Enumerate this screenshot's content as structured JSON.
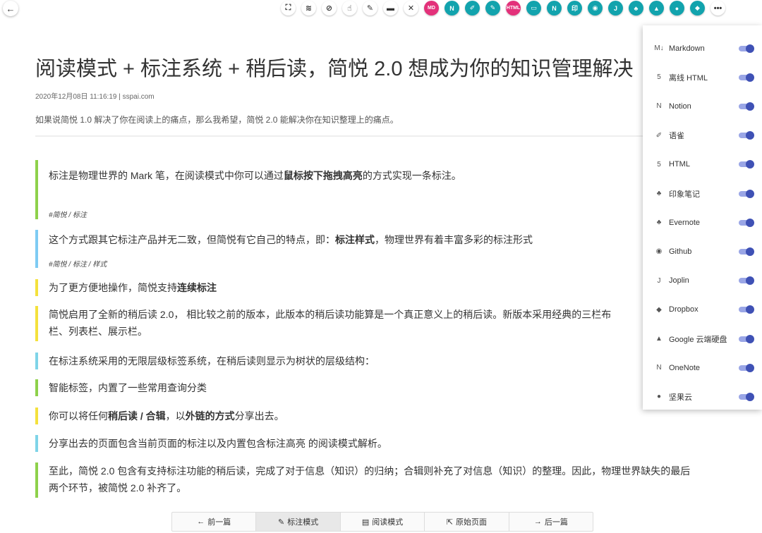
{
  "toolbar": {
    "back_icon": "←",
    "buttons": [
      {
        "name": "fullscreen-icon",
        "glyph": "⛶",
        "style": "light"
      },
      {
        "name": "layers-icon",
        "glyph": "≋",
        "style": "light"
      },
      {
        "name": "link-icon",
        "glyph": "⊘",
        "style": "light"
      },
      {
        "name": "hand-pointer-icon",
        "glyph": "☝",
        "style": "light"
      },
      {
        "name": "pen-icon",
        "glyph": "✎",
        "style": "light"
      },
      {
        "name": "archive-icon",
        "glyph": "▬",
        "style": "light"
      },
      {
        "name": "close-icon",
        "glyph": "✕",
        "style": "light"
      },
      {
        "name": "markdown-icon",
        "glyph": "MD",
        "style": "pink"
      },
      {
        "name": "notion-icon",
        "glyph": "N",
        "style": "teal"
      },
      {
        "name": "yuque-icon",
        "glyph": "✐",
        "style": "teal"
      },
      {
        "name": "pen-share-icon",
        "glyph": "✎",
        "style": "teal"
      },
      {
        "name": "html-icon",
        "glyph": "HTML",
        "style": "pink"
      },
      {
        "name": "message-icon",
        "glyph": "▭",
        "style": "teal"
      },
      {
        "name": "onenote-icon",
        "glyph": "N",
        "style": "teal"
      },
      {
        "name": "evernote-cn-icon",
        "glyph": "印",
        "style": "teal"
      },
      {
        "name": "github-icon",
        "glyph": "◉",
        "style": "teal"
      },
      {
        "name": "joplin-icon",
        "glyph": "J",
        "style": "teal"
      },
      {
        "name": "evernote-icon",
        "glyph": "♣",
        "style": "teal"
      },
      {
        "name": "google-drive-icon",
        "glyph": "▲",
        "style": "teal"
      },
      {
        "name": "jianguoyun-icon",
        "glyph": "●",
        "style": "teal"
      },
      {
        "name": "dropbox-icon",
        "glyph": "◆",
        "style": "teal"
      },
      {
        "name": "more-icon",
        "glyph": "•••",
        "style": "light"
      }
    ]
  },
  "article": {
    "title": "阅读模式 + 标注系统 + 稍后读，简悦 2.0 想成为你的知识管理解决",
    "meta": "2020年12月08日 11:16:19 | sspai.com",
    "description": "如果说简悦 1.0 解决了你在阅读上的痛点，那么我希望，简悦 2.0 能解决你在知识整理上的痛点。"
  },
  "blocks": [
    {
      "text_pre": "标注是物理世界的 Mark 笔，在阅读模式中你可以通过",
      "text_bold": "鼠标按下拖拽高亮",
      "text_post": "的方式实现一条标注。",
      "tag": "#简悦 / 标注",
      "color": "#8ed14b"
    },
    {
      "text_pre": "这个方式跟其它标注产品并无二致，但简悦有它自己的特点，即：",
      "text_bold": "标注样式",
      "text_post": "，物理世界有着丰富多彩的标注形式",
      "tag": "#简悦 / 标注 / 样式",
      "color": "#7ecbf3"
    },
    {
      "text_pre": "为了更方便地操作，简悦支持",
      "text_bold": "连续标注",
      "text_post": "",
      "color": "#f4e13c"
    },
    {
      "line1": "简悦启用了全新的稍后读 2.0， 相比较之前的版本，此版本的稍后读功能算是一个真正意义上的稍后读。新版本采用经典的三栏布",
      "line2": "栏、列表栏、展示栏。",
      "color": "#f4e13c"
    },
    {
      "text": "在标注系统采用的无限层级标签系统，在稍后读则显示为树状的层级结构：",
      "color": "#7fd4e8"
    },
    {
      "text": "智能标签，内置了一些常用查询分类",
      "color": "#8ed14b"
    },
    {
      "text_pre": "你可以将任何",
      "text_bold": "稍后读 / 合辑",
      "text_mid": "，以",
      "text_bold2": "外链的方式",
      "text_post": "分享出去。",
      "color": "#f4e13c"
    },
    {
      "text": "分享出去的页面包含当前页面的标注以及内置包含标注高亮 的阅读模式解析。",
      "color": "#7fd4e8"
    },
    {
      "line1": "至此，简悦 2.0 包含有支持标注功能的稍后读，完成了对于信息（知识）的归纳；合辑则补充了对信息（知识）的整理。因此，物理世界缺失的最后",
      "line2": "两个环节，被简悦 2.0 补齐了。",
      "color": "#8ed14b"
    }
  ],
  "export_panel": {
    "items": [
      {
        "label": "Markdown",
        "icon": "M↓",
        "name": "markdown-icon",
        "enabled": true
      },
      {
        "label": "离线 HTML",
        "icon": "5",
        "name": "html5-icon",
        "enabled": true
      },
      {
        "label": "Notion",
        "icon": "N",
        "name": "notion-icon",
        "enabled": true
      },
      {
        "label": "语雀",
        "icon": "✐",
        "name": "yuque-icon",
        "enabled": true
      },
      {
        "label": "HTML",
        "icon": "5",
        "name": "html-icon",
        "enabled": true
      },
      {
        "label": "印象笔记",
        "icon": "♣",
        "name": "evernote-cn-icon",
        "enabled": true
      },
      {
        "label": "Evernote",
        "icon": "♣",
        "name": "evernote-icon",
        "enabled": true
      },
      {
        "label": "Github",
        "icon": "◉",
        "name": "github-icon",
        "enabled": true
      },
      {
        "label": "Joplin",
        "icon": "J",
        "name": "joplin-icon",
        "enabled": true
      },
      {
        "label": "Dropbox",
        "icon": "◆",
        "name": "dropbox-icon",
        "enabled": true
      },
      {
        "label": "Google 云端硬盘",
        "icon": "▲",
        "name": "google-drive-icon",
        "enabled": true
      },
      {
        "label": "OneNote",
        "icon": "N",
        "name": "onenote-icon",
        "enabled": true
      },
      {
        "label": "坚果云",
        "icon": "●",
        "name": "jianguoyun-icon",
        "enabled": true
      }
    ]
  },
  "bottom_nav": {
    "items": [
      {
        "label": "前一篇",
        "icon": "←",
        "name": "prev-article-button"
      },
      {
        "label": "标注模式",
        "icon": "✎",
        "name": "annotation-mode-button",
        "active": true
      },
      {
        "label": "阅读模式",
        "icon": "▤",
        "name": "reading-mode-button"
      },
      {
        "label": "原始页面",
        "icon": "⇱",
        "name": "original-page-button"
      },
      {
        "label": "后一篇",
        "icon": "→",
        "name": "next-article-button"
      }
    ]
  },
  "colors": {
    "accent_toggle": "#3f51b5",
    "toolbar_teal": "#12a3ad",
    "toolbar_pink": "#e3317a"
  }
}
